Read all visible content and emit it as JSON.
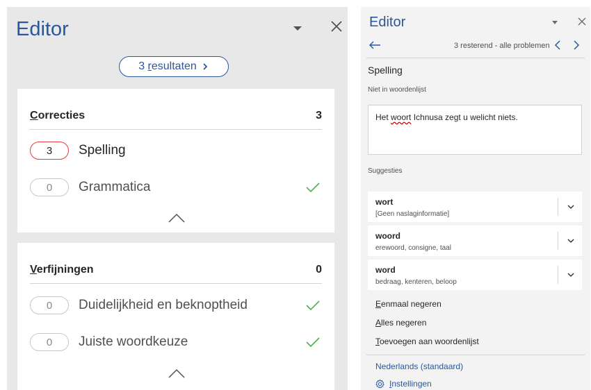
{
  "left_pane": {
    "title": "Editor",
    "results_button": {
      "count": "3",
      "label_accel": "r",
      "label_rest": "esultaten"
    },
    "corrections": {
      "title_accel": "C",
      "title_rest": "orrecties",
      "count": "3",
      "items": [
        {
          "count": "3",
          "label": "Spelling",
          "active": true
        },
        {
          "count": "0",
          "label": "Grammatica",
          "active": false
        }
      ]
    },
    "refinements": {
      "title_accel": "V",
      "title_rest": "erfijningen",
      "count": "0",
      "items": [
        {
          "count": "0",
          "label": "Duidelijkheid en beknoptheid",
          "active": false
        },
        {
          "count": "0",
          "label": "Juiste woordkeuze",
          "active": false
        }
      ]
    }
  },
  "right_pane": {
    "title": "Editor",
    "remaining": "3 resterend - alle problemen",
    "category": "Spelling",
    "issue_type": "Niet in woordenlijst",
    "context": {
      "before": "Het ",
      "error": "woort",
      "after": " Ichnusa zegt u welicht niets."
    },
    "suggestions_label": "Suggesties",
    "suggestions": [
      {
        "word": "wort",
        "info": "[Geen naslaginformatie]"
      },
      {
        "word": "woord",
        "info": "erewoord, consigne, taal"
      },
      {
        "word": "word",
        "info": "bedraag, kenteren, beloop"
      }
    ],
    "actions": [
      {
        "accel": "E",
        "rest": "enmaal negeren"
      },
      {
        "accel": "A",
        "rest": "lles negeren"
      },
      {
        "accel": "T",
        "rest": "oevoegen aan woordenlijst"
      }
    ],
    "language": "Nederlands (standaard)",
    "settings": {
      "accel": "I",
      "rest": "nstellingen"
    }
  },
  "colors": {
    "accent": "#2b579a",
    "error": "#e23f3f",
    "check": "#4caf50",
    "pane_left_bg": "#e8e8e8",
    "pane_right_bg": "#f3f3f3"
  },
  "icons": {
    "dropdown": "chevron-down-filled-icon",
    "close": "close-icon",
    "results_chevron": "chevron-right-icon",
    "check": "checkmark-icon",
    "collapse": "chevron-up-icon",
    "back": "arrow-left-icon",
    "prev": "chevron-left-icon",
    "next": "chevron-right-icon",
    "expand": "chevron-down-icon",
    "settings": "gear-icon"
  }
}
